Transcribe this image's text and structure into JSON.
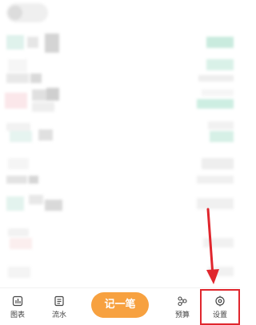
{
  "tabbar": {
    "items": [
      {
        "label": "图表",
        "icon": "bar-chart-icon"
      },
      {
        "label": "流水",
        "icon": "list-icon"
      },
      {
        "label": "预算",
        "icon": "budget-icon"
      },
      {
        "label": "设置",
        "icon": "gear-icon"
      }
    ],
    "primary_button_label": "记一笔"
  },
  "colors": {
    "accent": "#f7a140",
    "highlight": "#e0262d",
    "teal": "#79d1b7",
    "pink": "#ef9aa9"
  }
}
